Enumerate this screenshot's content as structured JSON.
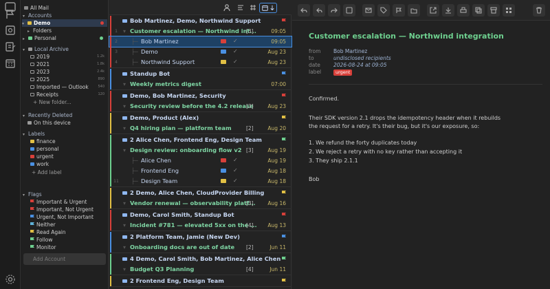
{
  "colors": {
    "accent": "#4a90e2",
    "green": "#6ed08f",
    "red": "#d8403a",
    "yellow": "#e2c044",
    "blue": "#4a90e2"
  },
  "sidebar": {
    "all_mail": "All Mail",
    "accounts": "Accounts",
    "demo": "Demo",
    "folders": "Folders",
    "personal": "Personal",
    "local_archive": "Local Archive",
    "archive_items": [
      {
        "label": "2019",
        "count": "1.2k"
      },
      {
        "label": "2021",
        "count": "1.8k"
      },
      {
        "label": "2023",
        "count": "2.4k"
      },
      {
        "label": "2025",
        "count": "890"
      },
      {
        "label": "Imported — Outlook",
        "count": "540"
      },
      {
        "label": "Receipts",
        "count": "120"
      }
    ],
    "new_folder": "+ New folder...",
    "recently_deleted": "Recently Deleted",
    "on_this_device": "On this device",
    "labels": "Labels",
    "label_items": [
      {
        "label": "finance",
        "color": "#e2c044"
      },
      {
        "label": "personal",
        "color": "#4a90e2"
      },
      {
        "label": "urgent",
        "color": "#d8403a"
      },
      {
        "label": "work",
        "color": "#4a90e2"
      }
    ],
    "add_label": "+ Add label",
    "flags": "Flags",
    "flag_items": [
      {
        "label": "Important & Urgent",
        "color": "#d8403a"
      },
      {
        "label": "Important, Not Urgent",
        "color": "#d8403a"
      },
      {
        "label": "Urgent, Not Important",
        "color": "#4a90e2"
      },
      {
        "label": "Neither",
        "color": "#5fb3d9"
      },
      {
        "label": "Read Again",
        "color": "#e2c044"
      },
      {
        "label": "Follow",
        "color": "#6ed08f"
      },
      {
        "label": "Monitor",
        "color": "#6ed08f"
      }
    ],
    "add_account": "Add Account"
  },
  "list": {
    "groups": [
      {
        "header": "Bob Martinez, Demo, Northwind Support",
        "bar": "#d8403a",
        "num": "",
        "subject": "Customer escalation — Northwind int...",
        "count": "[3]",
        "time": "09:05",
        "children": [
          {
            "num": "2",
            "name": "Bob Martinez",
            "time": "09:05"
          },
          {
            "num": "3",
            "name": "Demo",
            "time": "Aug 23"
          },
          {
            "num": "4",
            "name": "Northwind Support",
            "time": "Aug 23"
          }
        ]
      },
      {
        "header": "Standup Bot",
        "bar": "#4a90e2",
        "num": "",
        "subject": "Weekly metrics digest",
        "count": "",
        "time": "07:00",
        "children": []
      },
      {
        "header": "Demo, Bob Martinez, Security",
        "bar": "#d8403a",
        "num": "",
        "subject": "Security review before the 4.2 release",
        "count": "[3]",
        "time": "Aug 23",
        "children": []
      },
      {
        "header": "Demo, Product (Alex)",
        "bar": "#e2c044",
        "num": "",
        "subject": "Q4 hiring plan — platform team",
        "count": "[2]",
        "time": "Aug 20",
        "children": []
      },
      {
        "header": "2 Alice Chen, Frontend Eng, Design Team",
        "bar": "#6ed08f",
        "num": "",
        "subject": "Design review: onboarding flow v2",
        "count": "[3]",
        "time": "Aug 19",
        "children": [
          {
            "num": "",
            "name": "Alice Chen",
            "time": "Aug 19"
          },
          {
            "num": "",
            "name": "Frontend Eng",
            "time": "Aug 18"
          },
          {
            "num": "11",
            "name": "Design Team",
            "time": "Aug 18"
          }
        ]
      },
      {
        "header": "2 Demo, Alice Chen, CloudProvider Billing",
        "bar": "#e2c044",
        "num": "",
        "subject": "Vendor renewal — observability platf...",
        "count": "[3]",
        "time": "Aug 16",
        "children": []
      },
      {
        "header": "Demo, Carol Smith, Standup Bot",
        "bar": "#d8403a",
        "num": "",
        "subject": "Incident #781 — elevated 5xx on the ...",
        "count": "[4]",
        "time": "Aug 13",
        "children": []
      },
      {
        "header": "2 Platform Team, Jamie (New Dev)",
        "bar": "#4a90e2",
        "num": "",
        "subject": "Onboarding docs are out of date",
        "count": "[2]",
        "time": "Jun 11",
        "children": []
      },
      {
        "header": "4 Demo, Carol Smith, Bob Martinez, Alice Chen",
        "bar": "#6ed08f",
        "num": "",
        "subject": "Budget Q3 Planning",
        "count": "[4]",
        "time": "Jun 11",
        "children": []
      },
      {
        "header": "2 Frontend Eng, Design Team",
        "bar": "#e2c044",
        "num": "",
        "subject": "",
        "count": "",
        "time": "",
        "children": []
      }
    ]
  },
  "reader": {
    "subject": "Customer escalation — Northwind integration",
    "from_label": "from",
    "from": "Bob Martinez",
    "to_label": "to",
    "to": "undisclosed recipients",
    "date_label": "date",
    "date": "2026-08-24 at 09:05",
    "label_label": "label",
    "label": "urgent",
    "body": [
      "Confirmed.",
      "",
      "Their SDK version 2.1 drops the idempotency header when it rebuilds",
      "the request for a retry. It's their bug, but it's our exposure, so:",
      "",
      "1. We refund the forty duplicates today",
      "2. We reject a retry with no key rather than accepting it",
      "3. They ship 2.1.1",
      "",
      "Bob"
    ]
  }
}
